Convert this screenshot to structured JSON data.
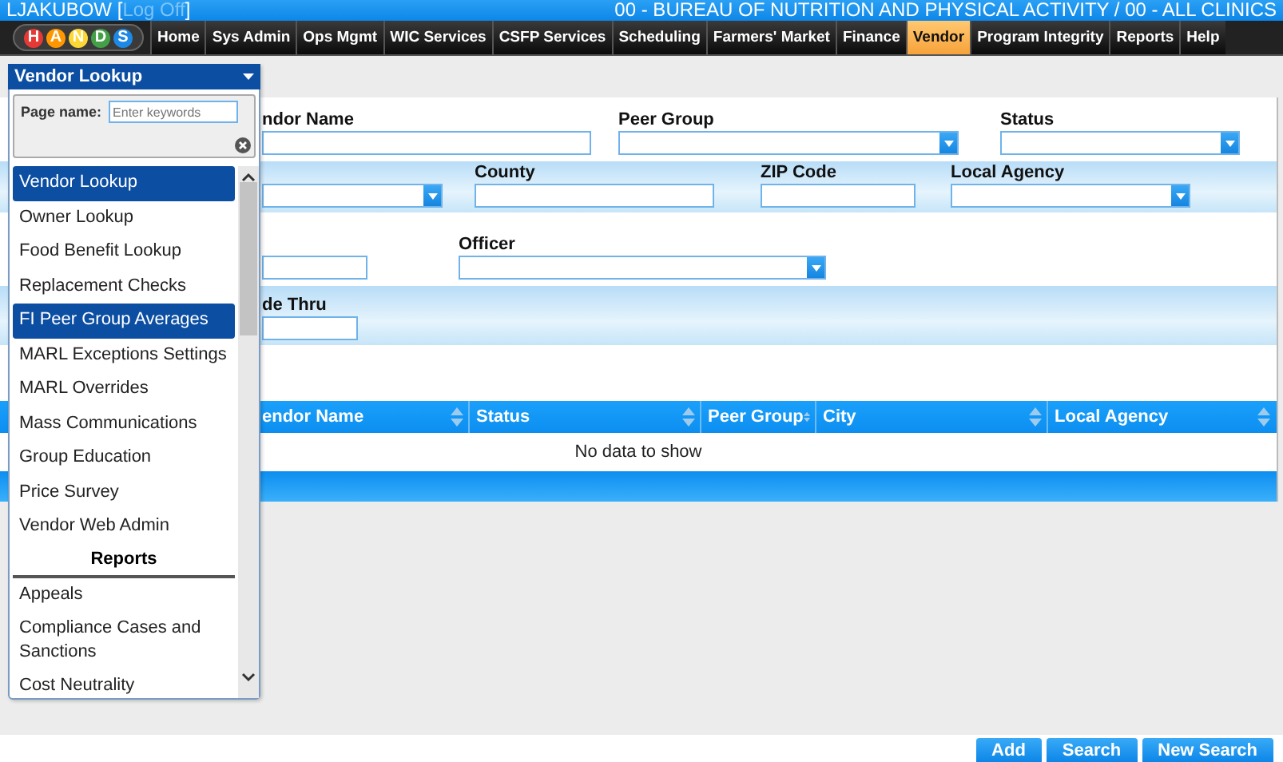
{
  "top_bar": {
    "user": "LJAKUBOW [",
    "log_off": "Log Off",
    "bracket_close": "]",
    "agency": "00 - BUREAU OF NUTRITION AND PHYSICAL ACTIVITY / 00 - ALL CLINICS"
  },
  "logo": {
    "letters": [
      "H",
      "A",
      "N",
      "D",
      "S"
    ]
  },
  "nav": [
    {
      "label": "Home",
      "selected": false
    },
    {
      "label": "Sys Admin",
      "selected": false
    },
    {
      "label": "Ops Mgmt",
      "selected": false
    },
    {
      "label": "WIC Services",
      "selected": false
    },
    {
      "label": "CSFP Services",
      "selected": false
    },
    {
      "label": "Scheduling",
      "selected": false
    },
    {
      "label": "Farmers' Market",
      "selected": false
    },
    {
      "label": "Finance",
      "selected": false
    },
    {
      "label": "Vendor",
      "selected": true
    },
    {
      "label": "Program Integrity",
      "selected": false
    },
    {
      "label": "Reports",
      "selected": false
    },
    {
      "label": "Help",
      "selected": false
    }
  ],
  "form": {
    "rows": [
      {
        "shaded": false,
        "fields": [
          {
            "label": "ndor Name",
            "kind": "text"
          },
          {
            "label": "Peer Group",
            "kind": "select"
          },
          {
            "label": "Status",
            "kind": "select"
          }
        ]
      },
      {
        "shaded": true,
        "fields": [
          {
            "kind": "select"
          },
          {
            "label": "County",
            "kind": "text"
          },
          {
            "label": "ZIP Code",
            "kind": "text"
          },
          {
            "label": "Local Agency",
            "kind": "select"
          }
        ]
      },
      {
        "shaded": false,
        "fields": [
          {
            "kind": "text"
          },
          {
            "label": "Officer",
            "kind": "select"
          }
        ]
      },
      {
        "shaded": true,
        "fields": [
          {
            "label": "de Thru",
            "kind": "text"
          }
        ]
      }
    ]
  },
  "table": {
    "columns": [
      "endor Name",
      "Status",
      "Peer Group",
      "City",
      "Local Agency"
    ],
    "empty_message": "No data to show"
  },
  "buttons": [
    "Add",
    "Search",
    "New Search"
  ],
  "page_menu": {
    "title": "Vendor Lookup",
    "search_label": "Page name:",
    "search_placeholder": "Enter keywords",
    "items": [
      {
        "kind": "item",
        "label": "Vendor Lookup",
        "selected": true
      },
      {
        "kind": "item",
        "label": "Owner Lookup",
        "selected": false
      },
      {
        "kind": "item",
        "label": "Food Benefit Lookup",
        "selected": false
      },
      {
        "kind": "item",
        "label": "Replacement Checks",
        "selected": false
      },
      {
        "kind": "item",
        "label": "FI Peer Group Averages",
        "selected": true
      },
      {
        "kind": "item",
        "label": "MARL Exceptions Settings",
        "selected": false
      },
      {
        "kind": "item",
        "label": "MARL Overrides",
        "selected": false
      },
      {
        "kind": "item",
        "label": "Mass Communications",
        "selected": false
      },
      {
        "kind": "item",
        "label": "Group Education",
        "selected": false
      },
      {
        "kind": "item",
        "label": "Price Survey",
        "selected": false
      },
      {
        "kind": "item",
        "label": "Vendor Web Admin",
        "selected": false
      },
      {
        "kind": "header",
        "label": "Reports"
      },
      {
        "kind": "item",
        "label": "Appeals",
        "selected": false
      },
      {
        "kind": "item",
        "label": "Compliance Cases and Sanctions",
        "selected": false
      },
      {
        "kind": "item",
        "label": "Cost Neutrality",
        "selected": false
      }
    ]
  }
}
